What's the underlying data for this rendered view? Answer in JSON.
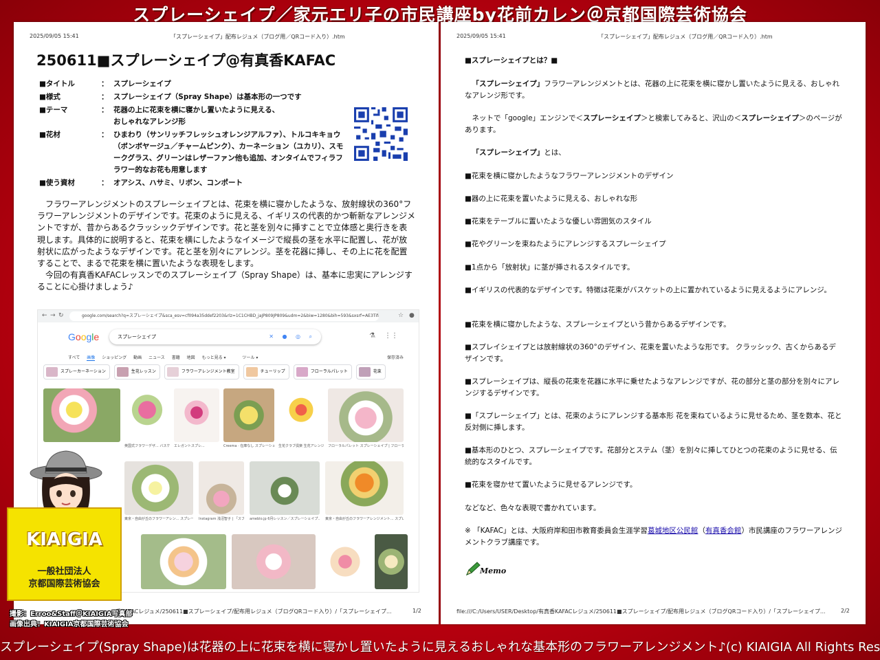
{
  "banner": {
    "title": "スプレーシェイプ／家元エリ子の市民講座by花前カレン＠京都国際芸術協会",
    "caption": "スプレーシェイプ(Spray Shape)は花器の上に花束を横に寝かし置いたように見えるおしゃれな基本形のフラワーアレンジメント♪(c) KIAIGIA All Rights Reserved."
  },
  "left_page": {
    "date": "2025/09/05 15:41",
    "file_title": "「スプレーシェイプ」配布レジュメ（ブログ用／QRコード入り）.htm",
    "heading": "250611■スプレーシェイプ@有真香KAFAC",
    "meta": [
      {
        "label": "■タイトル",
        "sep": "：",
        "value": "スプレーシェイプ"
      },
      {
        "label": "■様式",
        "sep": "：",
        "value": "スプレーシェイプ（Spray Shape）は基本形の一つです"
      },
      {
        "label": "■テーマ",
        "sep": "：",
        "value": "花器の上に花束を横に寝かし置いたように見える、おしゃれなアレンジ形"
      },
      {
        "label": "■花材",
        "sep": "：",
        "value": "ひまわり（サンリッチフレッシュオレンジアルファ）、トルコキキョウ（ボンボヤージュ／チャームピンク）、カーネーション（ユカリ）、スモークグラス、グリーンはレザーファン他も追加、オンタイムでフィラフラワー的なお花も用意します"
      },
      {
        "label": "■使う資材",
        "sep": "：",
        "value": "オアシス、ハサミ、リボン、コンポート"
      }
    ],
    "paragraph1": "フラワーアレンジメントのスプレーシェイプとは、花束を横に寝かしたような、放射線状の360°フラワーアレンジメントのデザインです。花束のように見える、イギリスの代表的かつ斬新なアレンジメントですが、昔からあるクラッシックデザインです。花と茎を別々に挿すことで立体感と奥行きを表現します。具体的に説明すると、花束を横にしたようなイメージで縦長の茎を水平に配置し、花が放射状に広がったようなデザインです。花と茎を別々にアレンジ。茎を花器に挿し、その上に花を配置することで、まるで花束を横に置いたような表現をします。",
    "paragraph2": "今回の有真香KAFACレッスンでのスプレーシェイプ（Spray Shape）は、基本に忠実にアレンジすることに心掛けましょう♪",
    "footer_path": "香KAFACレジュメ/250611■スプレーシェイプ/配布用レジュメ（ブログQRコード入り）/「スプレーシェイプ...",
    "page_num": "1/2"
  },
  "search_screenshot": {
    "url": "google.com/search?q=スプレーシェイプ&sca_esv=cf094a35ddef2203&rlz=1C1CHBD_jaJP809JP809&udm=2&biw=1280&bih=593&sxsrf=AE3TifNJsHrkDe...",
    "logo": "Google",
    "query": "スプレーシェイプ",
    "tabs": [
      "すべて",
      "画像",
      "ショッピング",
      "動画",
      "ニュース",
      "書籍",
      "地図",
      "もっと見る ▾",
      "ツール ▾"
    ],
    "safe_search": "保存済み",
    "chips": [
      "スプレーカーネーション",
      "生花レッスン",
      "フラワーアレンジメント教室",
      "チューリップ",
      "フローラルパレット",
      "花束"
    ],
    "captions_row1": [
      "東京・自由が丘のフラワーアレンジメ...",
      "英国式フラワーデザ... バスケットの秋のス...",
      "エレガントスプレ...",
      "Creema · 在庫なし スプレーシェイプ~イ...",
      "生花クラブ倶楽 生花アレンジメン...",
      "フローラルパレット スプレーシェイプ | フローラルパ..."
    ],
    "captions_row2": [
      "東京・自由が丘のフラワーアレン... スプレーシェイプ | 東京・自由...",
      "Instagram 浅沼智子 | 「スプレ...",
      "ameblo.jp 6月レッスン／スプレーシェイプ...",
      "東京・自由が丘のフラワーアレンジメント... スプレーシェイプ | 東京・自由が丘の..."
    ]
  },
  "logo": {
    "title": "KIAIGIA",
    "sub1": "一般社団法人",
    "sub2": "京都国際芸術協会"
  },
  "credits": {
    "line1": "撮影：Erroo&Staff＠KIAIGIA写真部",
    "line2": "画像出典：KIAIGIA京都国際芸術協会"
  },
  "right_page": {
    "date": "2025/09/05 15:41",
    "file_title": "「スプレーシェイプ」配布レジュメ（ブログ用／QRコード入り）.htm",
    "section_title": "■スプレーシェイプとは？■",
    "intro_bold": "「スプレーシェイプ」",
    "intro_rest": "フラワーアレンジメントとは、花器の上に花束を横に寝かし置いたように見える、おしゃれなアレンジ形です。",
    "google_pre": "ネットで「google」エンジンで＜",
    "google_term": "スプレーシェイプ",
    "google_mid": "＞と検索してみると、沢山の＜",
    "google_term2": "スプレーシェイプ",
    "google_post": "＞のページがあります。",
    "toha_bold": "「スプレーシェイプ」",
    "toha_rest": "とは、",
    "bullets": [
      "■花束を横に寝かしたようなフラワーアレンジメントのデザイン",
      "■器の上に花束を置いたように見える、おしゃれな形",
      "■花束をテーブルに置いたような優しい雰囲気のスタイル",
      "■花やグリーンを束ねたようにアレンジするスプレーシェイプ",
      "■1点から「放射状」に茎が挿されるスタイルです。",
      "■イギリスの代表的なデザインです。特徴は花束がバスケットの上に置かれているように見えるようにアレンジ。",
      "■花束を横に寝かしたような、スプレーシェイプという昔からあるデザインです。",
      "■スプレイシェイプとは放射線状の360°のデザイン、花束を置いたような形です。 クラッシック、古くからあるデザインです。",
      "■スプレーシェイプは、縦長の花束を花器に水平に乗せたようなアレンジですが、花の部分と茎の部分を別々にアレンジするデザインです。",
      "■「スプレーシェイプ」とは、花束のようにアレンジする基本形 花を束ねているように見せるため、茎を数本、花と反対側に挿します。",
      "■基本形のひとつ、スプレーシェイプです。花部分とステム（茎）を別々に挿してひとつの花束のように見せる、伝統的なスタイルです。",
      "■花束を寝かせて置いたように見せるアレンジです。"
    ],
    "closing": "などなど、色々な表現で書かれています。",
    "note_pre": "※ 「KAFAC」とは、大阪府岸和田市教育委員会生涯学習",
    "note_link1": "葛城地区公民館",
    "note_mid1": "（",
    "note_link2": "有真香会館",
    "note_post": "）市民講座のフラワーアレンジメントクラブ講座です。",
    "memo": "Memo",
    "footer_path": "file:///C:/Users/USER/Desktop/有真香KAFACレジュメ/250611■スプレーシェイプ/配布用レジュメ（ブログQRコード入り）/「スプレーシェイプ...",
    "page_num": "2/2"
  }
}
